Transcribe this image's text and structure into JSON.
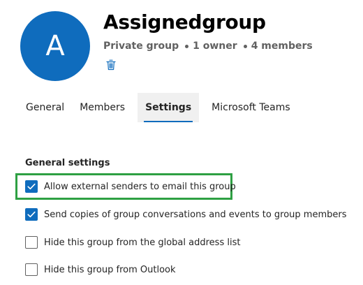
{
  "group": {
    "avatar_letter": "A",
    "name": "Assignedgroup",
    "privacy": "Private group",
    "owners": "1 owner",
    "members": "4 members",
    "avatar_color": "#0f6cbd"
  },
  "icons": {
    "delete": "trash-icon",
    "check": "checkmark-icon"
  },
  "tabs": [
    {
      "label": "General"
    },
    {
      "label": "Members"
    },
    {
      "label": "Settings"
    },
    {
      "label": "Microsoft Teams"
    }
  ],
  "active_tab": "Settings",
  "settings": {
    "section_title": "General settings",
    "items": [
      {
        "label": "Allow external senders to email this group",
        "checked": true
      },
      {
        "label": "Send copies of group conversations and events to group members",
        "checked": true
      },
      {
        "label": "Hide this group from the global address list",
        "checked": false
      },
      {
        "label": "Hide this group from Outlook",
        "checked": false
      }
    ]
  },
  "colors": {
    "accent": "#0f6cbd",
    "highlight": "#2ea043",
    "tab_active_bg": "#f0f0f0"
  }
}
